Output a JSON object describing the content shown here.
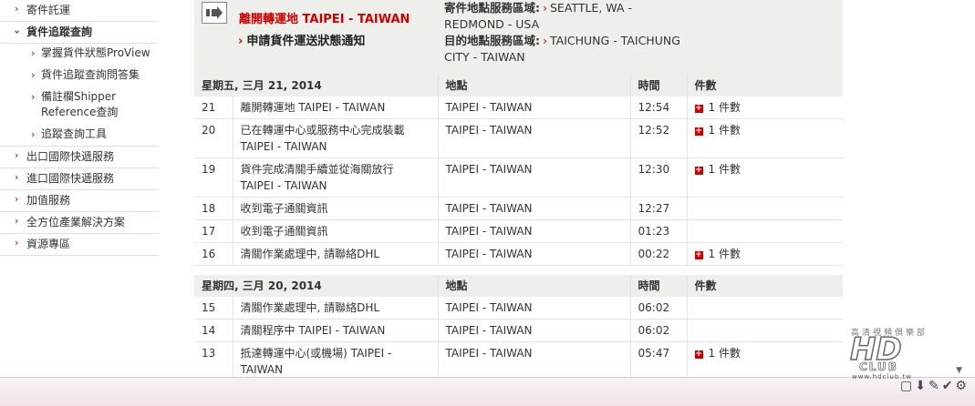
{
  "sidebar": {
    "items": [
      {
        "label": "寄件託運"
      },
      {
        "label": "貨件追蹤查詢"
      },
      {
        "label": "出口國際快遞服務"
      },
      {
        "label": "進口國際快遞服務"
      },
      {
        "label": "加值服務"
      },
      {
        "label": "全方位產業解決方案"
      },
      {
        "label": "資源專區"
      }
    ],
    "subitems": [
      {
        "label": "掌握貨件狀態ProView"
      },
      {
        "label": "貨件追蹤查詢問答集"
      },
      {
        "label": "備註欄Shipper Reference查詢"
      },
      {
        "label": "追蹤查詢工具"
      }
    ]
  },
  "header": {
    "transit_status": "離開轉運地 TAIPEI - TAIWAN",
    "notify_link": "申請貨件運送狀態通知",
    "origin_label": "寄件地點服務區域:",
    "origin_value": "SEATTLE, WA - REDMOND - USA",
    "dest_label": "目的地點服務區域:",
    "dest_value": "TAICHUNG - TAICHUNG CITY - TAIWAN"
  },
  "columns": {
    "location": "地點",
    "time": "時間",
    "pieces": "件數"
  },
  "groups": [
    {
      "date": "星期五, 三月 21, 2014",
      "rows": [
        {
          "num": "21",
          "desc": "離開轉運地 TAIPEI - TAIWAN",
          "loc": "TAIPEI - TAIWAN",
          "time": "12:54",
          "pieces": "1 件數"
        },
        {
          "num": "20",
          "desc": "已在轉運中心或服務中心完成裝載 TAIPEI - TAIWAN",
          "loc": "TAIPEI - TAIWAN",
          "time": "12:52",
          "pieces": "1 件數"
        },
        {
          "num": "19",
          "desc": "貨件完成清關手續並從海關放行 TAIPEI - TAIWAN",
          "loc": "TAIPEI - TAIWAN",
          "time": "12:30",
          "pieces": "1 件數"
        },
        {
          "num": "18",
          "desc": "收到電子通關資訊",
          "loc": "TAIPEI - TAIWAN",
          "time": "12:27",
          "pieces": ""
        },
        {
          "num": "17",
          "desc": "收到電子通關資訊",
          "loc": "TAIPEI - TAIWAN",
          "time": "01:23",
          "pieces": ""
        },
        {
          "num": "16",
          "desc": "清關作業處理中, 請聯絡DHL",
          "loc": "TAIPEI - TAIWAN",
          "time": "00:22",
          "pieces": "1 件數"
        }
      ]
    },
    {
      "date": "星期四, 三月 20, 2014",
      "rows": [
        {
          "num": "15",
          "desc": "清關作業處理中, 請聯絡DHL",
          "loc": "TAIPEI - TAIWAN",
          "time": "06:02",
          "pieces": ""
        },
        {
          "num": "14",
          "desc": "清關程序中 TAIPEI - TAIWAN",
          "loc": "TAIPEI - TAIWAN",
          "time": "06:02",
          "pieces": ""
        },
        {
          "num": "13",
          "desc": "抵達轉運中心(或機場) TAIPEI - TAIWAN",
          "loc": "TAIPEI - TAIWAN",
          "time": "05:47",
          "pieces": "1 件數"
        }
      ]
    }
  ],
  "watermark": {
    "brand": "HD",
    "sub": "CLUB",
    "kanji": "高清視頻俱樂部",
    "site": "www.hdclub.tw"
  },
  "colors": {
    "accent": "#cc0000",
    "header_bg": "#eeeeea"
  }
}
